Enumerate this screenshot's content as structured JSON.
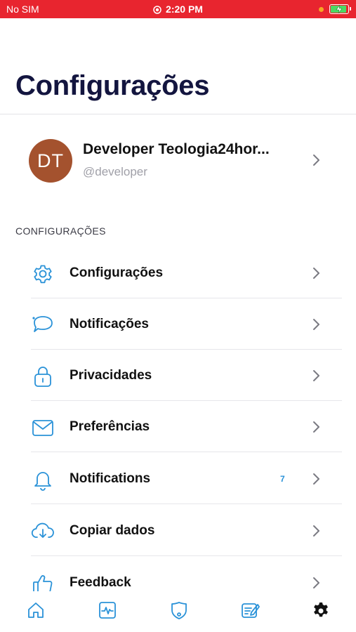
{
  "status_bar": {
    "carrier": "No SIM",
    "time": "2:20 PM"
  },
  "page": {
    "title": "Configurações"
  },
  "profile": {
    "initials": "DT",
    "name": "Developer Teologia24hor...",
    "handle": "@developer"
  },
  "section": {
    "header": "CONFIGURAÇÕES"
  },
  "menu": {
    "items": [
      {
        "label": "Configurações",
        "icon": "gear-icon"
      },
      {
        "label": "Notificações",
        "icon": "chat-bubble-icon"
      },
      {
        "label": "Privacidades",
        "icon": "lock-icon"
      },
      {
        "label": "Preferências",
        "icon": "mail-icon"
      },
      {
        "label": "Notifications",
        "icon": "bell-icon",
        "badge": "7"
      },
      {
        "label": "Copiar dados",
        "icon": "cloud-download-icon"
      },
      {
        "label": "Feedback",
        "icon": "thumbs-up-icon"
      }
    ]
  },
  "tab_bar": {
    "tabs": [
      {
        "icon": "home-icon"
      },
      {
        "icon": "activity-icon"
      },
      {
        "icon": "shield-icon"
      },
      {
        "icon": "notes-icon"
      },
      {
        "icon": "settings-gear-icon",
        "active": true
      }
    ]
  },
  "colors": {
    "status_bar": "#e8252f",
    "title": "#13153f",
    "icon_accent": "#2a92d8",
    "avatar": "#a4522e",
    "active_tab": "#111111"
  }
}
